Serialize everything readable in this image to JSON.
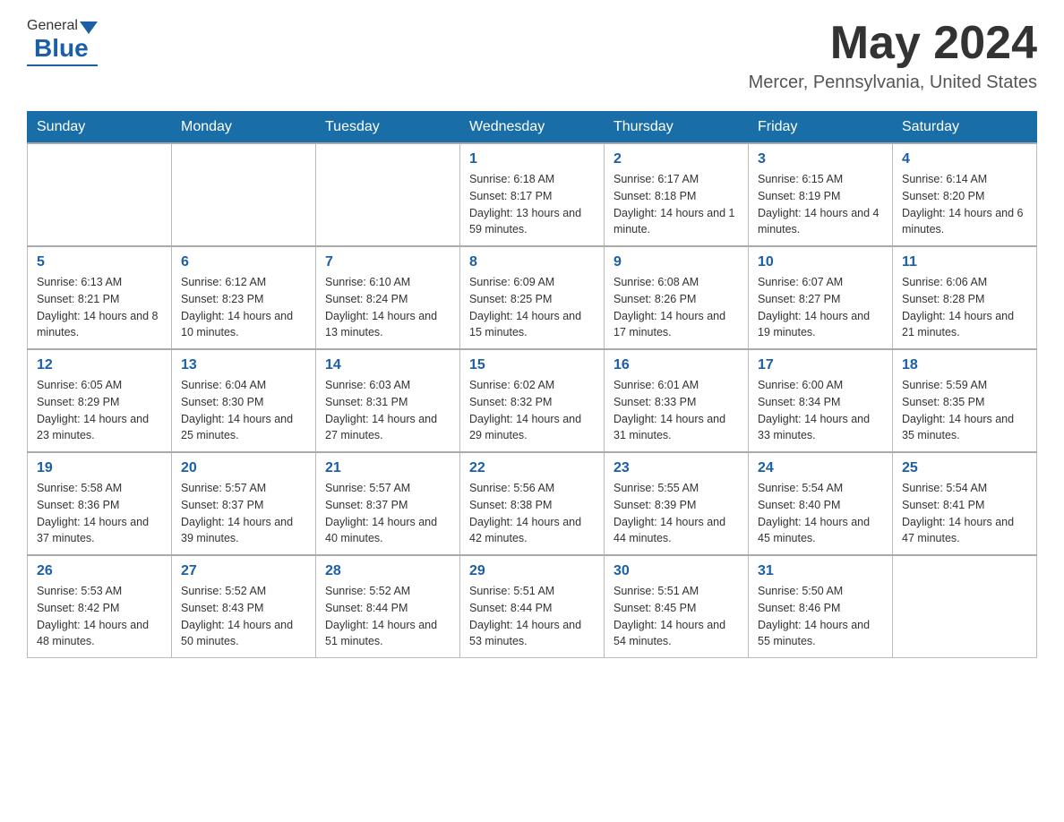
{
  "header": {
    "logo_general": "General",
    "logo_blue": "Blue",
    "month_year": "May 2024",
    "location": "Mercer, Pennsylvania, United States"
  },
  "days_of_week": [
    "Sunday",
    "Monday",
    "Tuesday",
    "Wednesday",
    "Thursday",
    "Friday",
    "Saturday"
  ],
  "weeks": [
    [
      {
        "day": "",
        "info": ""
      },
      {
        "day": "",
        "info": ""
      },
      {
        "day": "",
        "info": ""
      },
      {
        "day": "1",
        "info": "Sunrise: 6:18 AM\nSunset: 8:17 PM\nDaylight: 13 hours\nand 59 minutes."
      },
      {
        "day": "2",
        "info": "Sunrise: 6:17 AM\nSunset: 8:18 PM\nDaylight: 14 hours\nand 1 minute."
      },
      {
        "day": "3",
        "info": "Sunrise: 6:15 AM\nSunset: 8:19 PM\nDaylight: 14 hours\nand 4 minutes."
      },
      {
        "day": "4",
        "info": "Sunrise: 6:14 AM\nSunset: 8:20 PM\nDaylight: 14 hours\nand 6 minutes."
      }
    ],
    [
      {
        "day": "5",
        "info": "Sunrise: 6:13 AM\nSunset: 8:21 PM\nDaylight: 14 hours\nand 8 minutes."
      },
      {
        "day": "6",
        "info": "Sunrise: 6:12 AM\nSunset: 8:23 PM\nDaylight: 14 hours\nand 10 minutes."
      },
      {
        "day": "7",
        "info": "Sunrise: 6:10 AM\nSunset: 8:24 PM\nDaylight: 14 hours\nand 13 minutes."
      },
      {
        "day": "8",
        "info": "Sunrise: 6:09 AM\nSunset: 8:25 PM\nDaylight: 14 hours\nand 15 minutes."
      },
      {
        "day": "9",
        "info": "Sunrise: 6:08 AM\nSunset: 8:26 PM\nDaylight: 14 hours\nand 17 minutes."
      },
      {
        "day": "10",
        "info": "Sunrise: 6:07 AM\nSunset: 8:27 PM\nDaylight: 14 hours\nand 19 minutes."
      },
      {
        "day": "11",
        "info": "Sunrise: 6:06 AM\nSunset: 8:28 PM\nDaylight: 14 hours\nand 21 minutes."
      }
    ],
    [
      {
        "day": "12",
        "info": "Sunrise: 6:05 AM\nSunset: 8:29 PM\nDaylight: 14 hours\nand 23 minutes."
      },
      {
        "day": "13",
        "info": "Sunrise: 6:04 AM\nSunset: 8:30 PM\nDaylight: 14 hours\nand 25 minutes."
      },
      {
        "day": "14",
        "info": "Sunrise: 6:03 AM\nSunset: 8:31 PM\nDaylight: 14 hours\nand 27 minutes."
      },
      {
        "day": "15",
        "info": "Sunrise: 6:02 AM\nSunset: 8:32 PM\nDaylight: 14 hours\nand 29 minutes."
      },
      {
        "day": "16",
        "info": "Sunrise: 6:01 AM\nSunset: 8:33 PM\nDaylight: 14 hours\nand 31 minutes."
      },
      {
        "day": "17",
        "info": "Sunrise: 6:00 AM\nSunset: 8:34 PM\nDaylight: 14 hours\nand 33 minutes."
      },
      {
        "day": "18",
        "info": "Sunrise: 5:59 AM\nSunset: 8:35 PM\nDaylight: 14 hours\nand 35 minutes."
      }
    ],
    [
      {
        "day": "19",
        "info": "Sunrise: 5:58 AM\nSunset: 8:36 PM\nDaylight: 14 hours\nand 37 minutes."
      },
      {
        "day": "20",
        "info": "Sunrise: 5:57 AM\nSunset: 8:37 PM\nDaylight: 14 hours\nand 39 minutes."
      },
      {
        "day": "21",
        "info": "Sunrise: 5:57 AM\nSunset: 8:37 PM\nDaylight: 14 hours\nand 40 minutes."
      },
      {
        "day": "22",
        "info": "Sunrise: 5:56 AM\nSunset: 8:38 PM\nDaylight: 14 hours\nand 42 minutes."
      },
      {
        "day": "23",
        "info": "Sunrise: 5:55 AM\nSunset: 8:39 PM\nDaylight: 14 hours\nand 44 minutes."
      },
      {
        "day": "24",
        "info": "Sunrise: 5:54 AM\nSunset: 8:40 PM\nDaylight: 14 hours\nand 45 minutes."
      },
      {
        "day": "25",
        "info": "Sunrise: 5:54 AM\nSunset: 8:41 PM\nDaylight: 14 hours\nand 47 minutes."
      }
    ],
    [
      {
        "day": "26",
        "info": "Sunrise: 5:53 AM\nSunset: 8:42 PM\nDaylight: 14 hours\nand 48 minutes."
      },
      {
        "day": "27",
        "info": "Sunrise: 5:52 AM\nSunset: 8:43 PM\nDaylight: 14 hours\nand 50 minutes."
      },
      {
        "day": "28",
        "info": "Sunrise: 5:52 AM\nSunset: 8:44 PM\nDaylight: 14 hours\nand 51 minutes."
      },
      {
        "day": "29",
        "info": "Sunrise: 5:51 AM\nSunset: 8:44 PM\nDaylight: 14 hours\nand 53 minutes."
      },
      {
        "day": "30",
        "info": "Sunrise: 5:51 AM\nSunset: 8:45 PM\nDaylight: 14 hours\nand 54 minutes."
      },
      {
        "day": "31",
        "info": "Sunrise: 5:50 AM\nSunset: 8:46 PM\nDaylight: 14 hours\nand 55 minutes."
      },
      {
        "day": "",
        "info": ""
      }
    ]
  ]
}
